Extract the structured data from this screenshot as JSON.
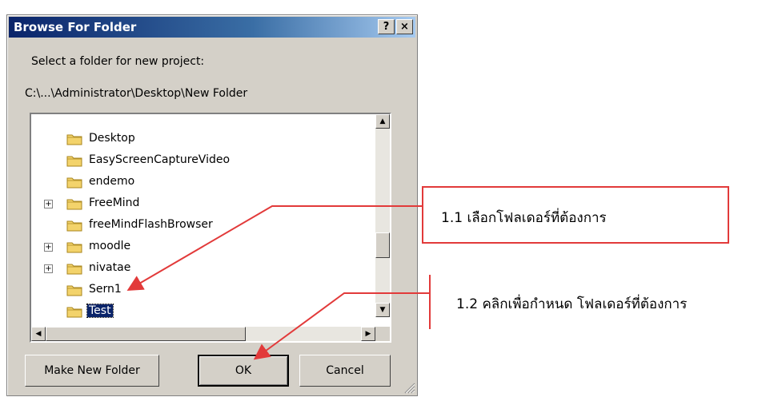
{
  "dialog": {
    "title": "Browse For Folder",
    "help_label": "?",
    "close_label": "×",
    "prompt": "Select a folder for new project:",
    "path": "C:\\...\\Administrator\\Desktop\\New Folder"
  },
  "tree": {
    "items": [
      {
        "label": "Desktop",
        "expander": ""
      },
      {
        "label": "EasyScreenCaptureVideo",
        "expander": ""
      },
      {
        "label": "endemo",
        "expander": ""
      },
      {
        "label": "FreeMind",
        "expander": "+"
      },
      {
        "label": "freeMindFlashBrowser",
        "expander": ""
      },
      {
        "label": "moodle",
        "expander": "+"
      },
      {
        "label": "nivatae",
        "expander": "+"
      },
      {
        "label": "Sern1",
        "expander": ""
      },
      {
        "label": "Test",
        "expander": "",
        "selected": true
      },
      {
        "label": "...",
        "expander": ""
      }
    ]
  },
  "buttons": {
    "make_new_folder": "Make New Folder",
    "ok": "OK",
    "cancel": "Cancel"
  },
  "annotations": {
    "step1": "1.1 เลือกโฟลเดอร์ที่ต้องการ",
    "step2": "1.2 คลิกเพื่อกำหนด โฟลเดอร์ที่ต้องการ",
    "accent_color": "#e23a3a"
  }
}
